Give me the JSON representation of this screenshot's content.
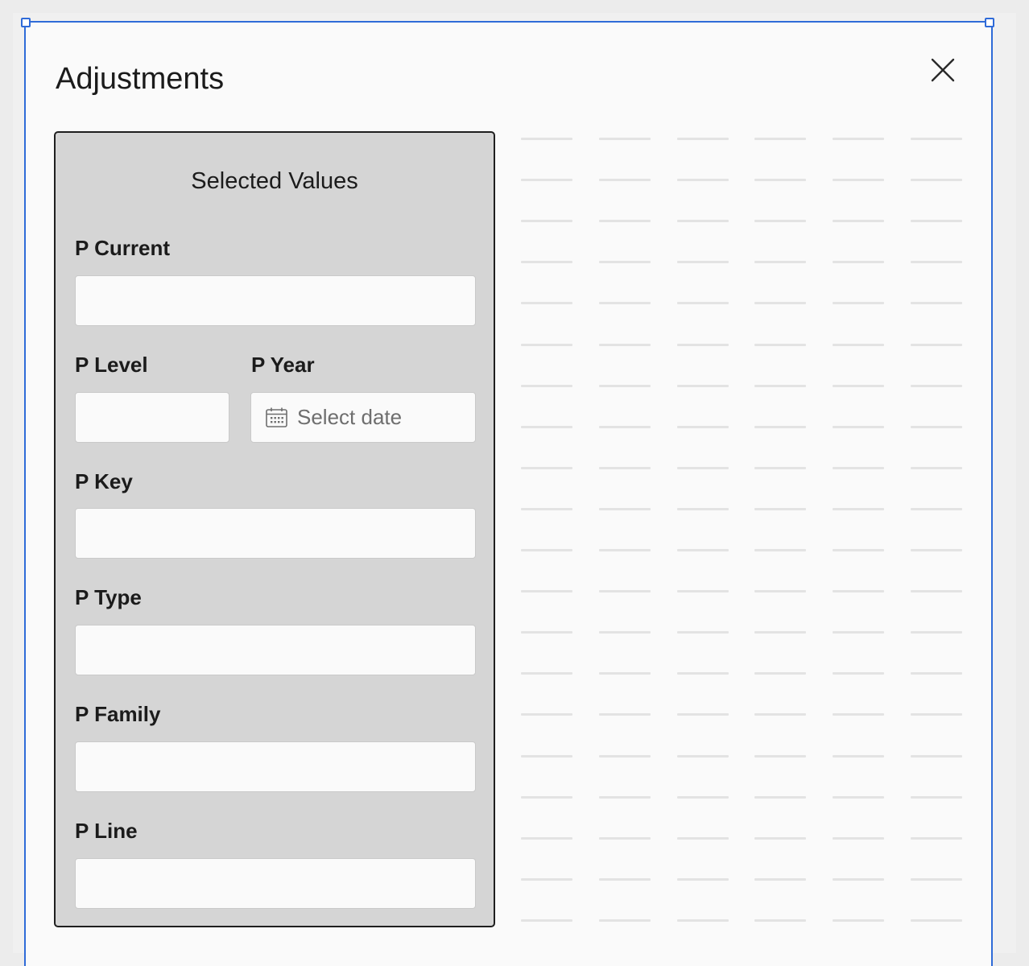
{
  "dialog": {
    "title": "Adjustments",
    "close_icon": "close-icon"
  },
  "panel": {
    "title": "Selected Values",
    "fields": {
      "p_current": {
        "label": "P Current",
        "value": ""
      },
      "p_level": {
        "label": "P Level",
        "value": ""
      },
      "p_year": {
        "label": "P Year",
        "placeholder": "Select date",
        "icon": "calendar-icon"
      },
      "p_key": {
        "label": "P Key",
        "value": ""
      },
      "p_type": {
        "label": "P Type",
        "value": ""
      },
      "p_family": {
        "label": "P Family",
        "value": ""
      },
      "p_line": {
        "label": "P Line",
        "value": ""
      }
    }
  },
  "colors": {
    "selection_border": "#2f6bd8",
    "panel_background": "#d5d5d5",
    "panel_border": "#1f1f1f",
    "input_background": "#fafafa",
    "placeholder_text": "#6e6e6e",
    "grid_line": "#e3e3e3"
  }
}
